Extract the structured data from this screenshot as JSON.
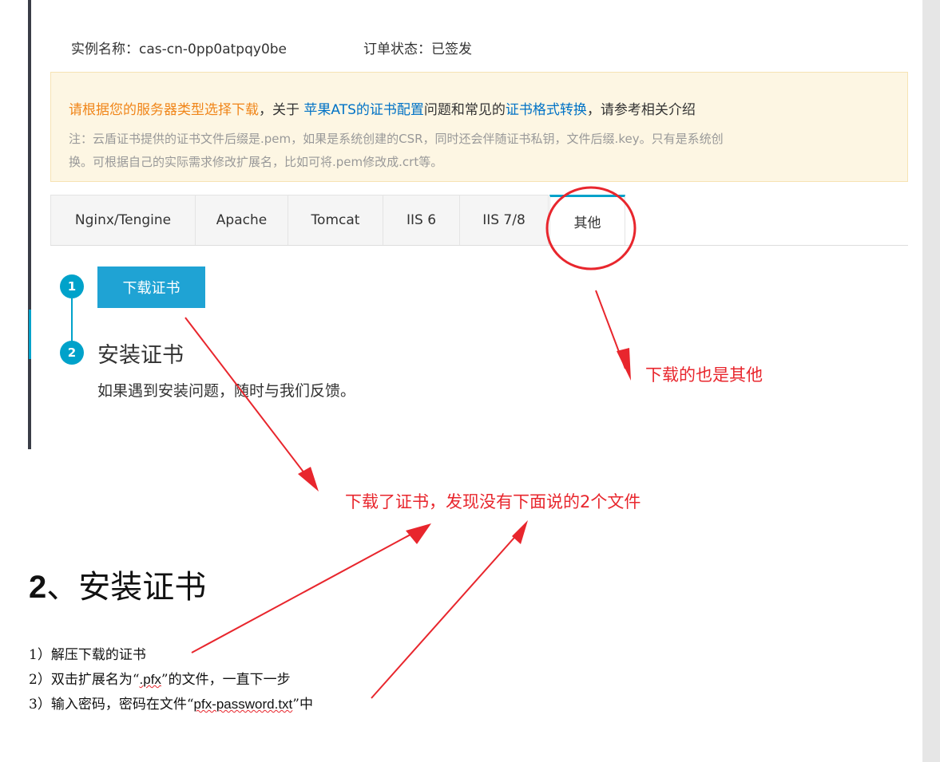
{
  "instance": {
    "label": "实例名称：",
    "value": "cas-cn-0pp0atpqy0be"
  },
  "order": {
    "label": "订单状态：",
    "value": "已签发"
  },
  "notice": {
    "lead": "请根据您的服务器类型选择下载",
    "mid1": "，关于",
    "link1": "苹果ATS的证书配置",
    "mid2": "问题和常见的",
    "link2": "证书格式转换",
    "tail": "，请参考相关介绍",
    "note1": "注：云盾证书提供的证书文件后缀是.pem，如果是系统创建的CSR，同时还会伴随证书私钥，文件后缀.key。只有是系统创",
    "note2": "换。可根据自己的实际需求修改扩展名，比如可将.pem修改成.crt等。"
  },
  "tabs": [
    "Nginx/Tengine",
    "Apache",
    "Tomcat",
    "IIS 6",
    "IIS 7/8",
    "其他"
  ],
  "steps": {
    "step1_num": "1",
    "download_button": "下载证书",
    "step2_num": "2",
    "step2_title": "安装证书",
    "step2_desc": "如果遇到安装问题，随时与我们反馈。"
  },
  "annotations": {
    "other_note": "下载的也是其他",
    "missing_files_note": "下载了证书，发现没有下面说的2个文件"
  },
  "doc": {
    "heading_num": "2",
    "heading_text": "、安装证书",
    "line1": "1）解压下载的证书",
    "line2_a": "2）双击扩展名为“",
    "line2_b": ".pfx",
    "line2_c": "”的文件，一直下一步",
    "line3_a": "3）输入密码，密码在文件“",
    "line3_b": "pfx-password.txt",
    "line3_c": "”中"
  },
  "colors": {
    "accent": "#00a2ca",
    "annotation_red": "#e8262d",
    "notice_orange": "#f08519",
    "link_blue": "#0072c6"
  }
}
